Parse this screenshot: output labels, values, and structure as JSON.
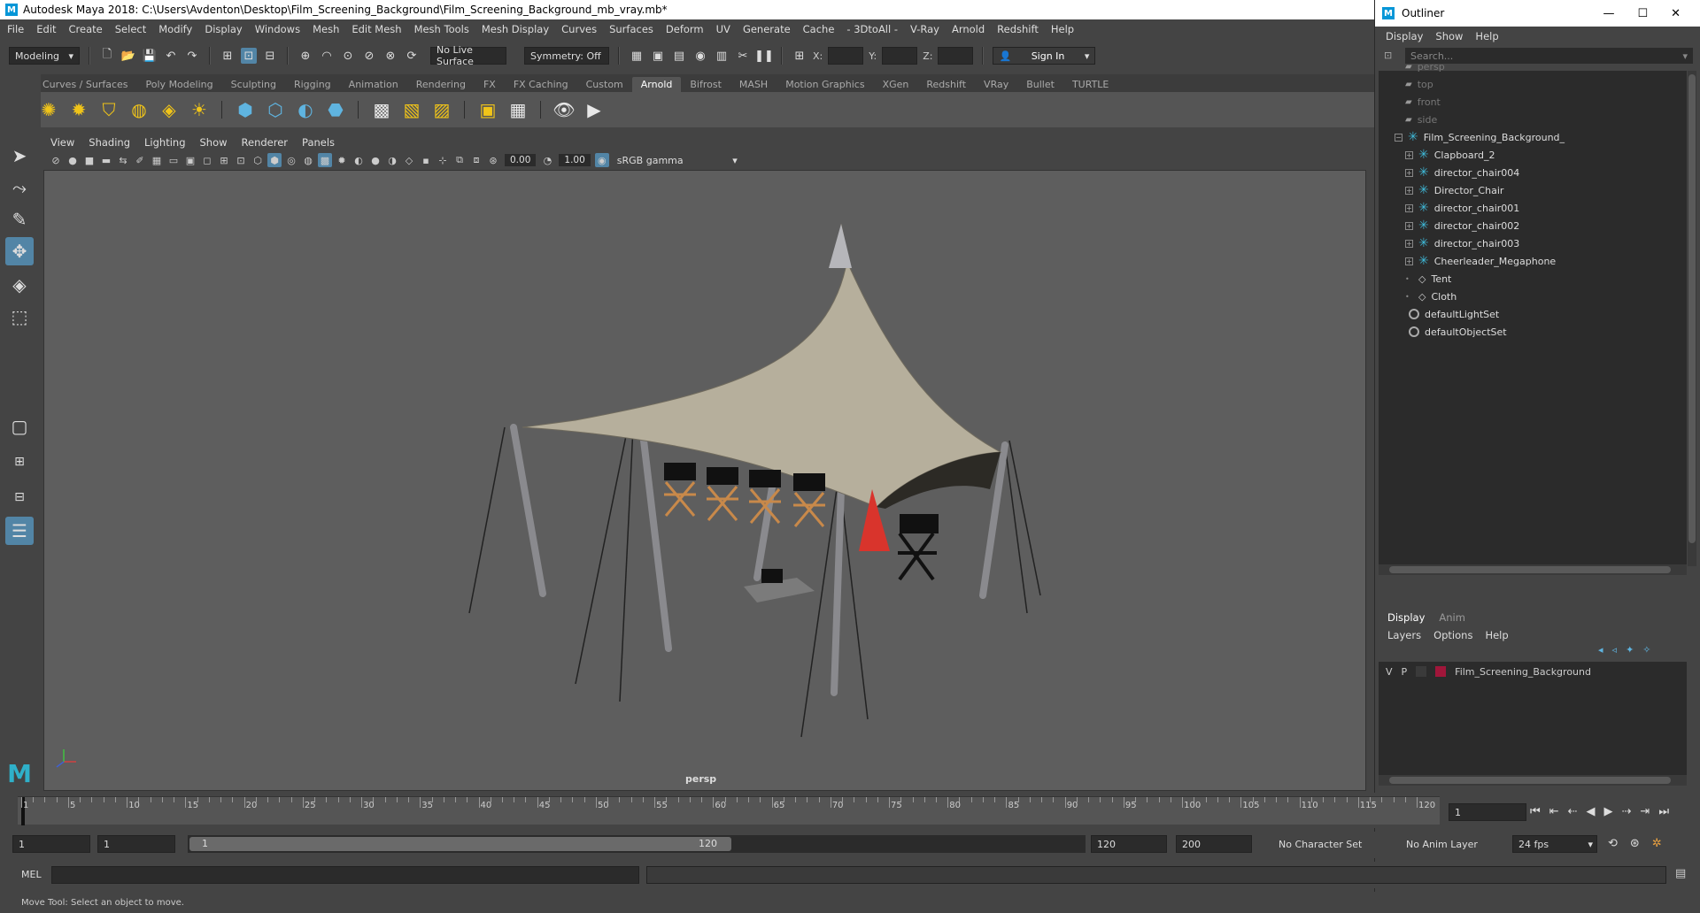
{
  "window": {
    "title": "Autodesk Maya 2018: C:\\Users\\Avdenton\\Desktop\\Film_Screening_Background\\Film_Screening_Background_mb_vray.mb*"
  },
  "menubar": [
    "File",
    "Edit",
    "Create",
    "Select",
    "Modify",
    "Display",
    "Windows",
    "Mesh",
    "Edit Mesh",
    "Mesh Tools",
    "Mesh Display",
    "Curves",
    "Surfaces",
    "Deform",
    "UV",
    "Generate",
    "Cache",
    "- 3DtoAll -",
    "V-Ray",
    "Arnold",
    "Redshift",
    "Help"
  ],
  "statusline": {
    "mode": "Modeling",
    "live_surface": "No Live Surface",
    "symmetry": "Symmetry: Off",
    "x_label": "X:",
    "y_label": "Y:",
    "z_label": "Z:",
    "sign_in": "Sign In"
  },
  "shelf": {
    "tabs": [
      "Curves / Surfaces",
      "Poly Modeling",
      "Sculpting",
      "Rigging",
      "Animation",
      "Rendering",
      "FX",
      "FX Caching",
      "Custom",
      "Arnold",
      "Bifrost",
      "MASH",
      "Motion Graphics",
      "XGen",
      "Redshift",
      "VRay",
      "Bullet",
      "TURTLE"
    ],
    "active_tab": "Arnold"
  },
  "viewport": {
    "menu": [
      "View",
      "Shading",
      "Lighting",
      "Show",
      "Renderer",
      "Panels"
    ],
    "exposure": "0.00",
    "gamma": "1.00",
    "color_space": "sRGB gamma",
    "camera_label": "persp"
  },
  "outliner": {
    "title": "Outliner",
    "menu": [
      "Display",
      "Show",
      "Help"
    ],
    "search_placeholder": "Search...",
    "cameras": [
      "persp",
      "top",
      "front",
      "side"
    ],
    "root": "Film_Screening_Background_",
    "children": [
      "Clapboard_2",
      "director_chair004",
      "Director_Chair",
      "director_chair001",
      "director_chair002",
      "director_chair003",
      "Cheerleader_Megaphone",
      "Tent",
      "Cloth"
    ],
    "sets": [
      "defaultLightSet",
      "defaultObjectSet"
    ]
  },
  "layer_editor": {
    "tabs": [
      "Display",
      "Anim"
    ],
    "active_tab": "Display",
    "menu": [
      "Layers",
      "Options",
      "Help"
    ],
    "layer": {
      "v": "V",
      "p": "P",
      "name": "Film_Screening_Background",
      "color": "#a0163a"
    }
  },
  "timeline": {
    "ticks": [
      "1",
      "5",
      "10",
      "15",
      "20",
      "25",
      "30",
      "35",
      "40",
      "45",
      "50",
      "55",
      "60",
      "65",
      "70",
      "75",
      "80",
      "85",
      "90",
      "95",
      "100",
      "105",
      "110",
      "115",
      "120"
    ],
    "current_frame": "1"
  },
  "range": {
    "start": "1",
    "playback_start": "1",
    "slider_start": "1",
    "slider_end": "120",
    "playback_end": "120",
    "end": "200",
    "character_set": "No Character Set",
    "anim_layer": "No Anim Layer",
    "fps": "24 fps"
  },
  "command": {
    "lang": "MEL"
  },
  "helpline": "Move Tool: Select an object to move.",
  "colors": {
    "accent": "#5285a6",
    "maya_blue": "#0696d7",
    "layer": "#a0163a"
  }
}
